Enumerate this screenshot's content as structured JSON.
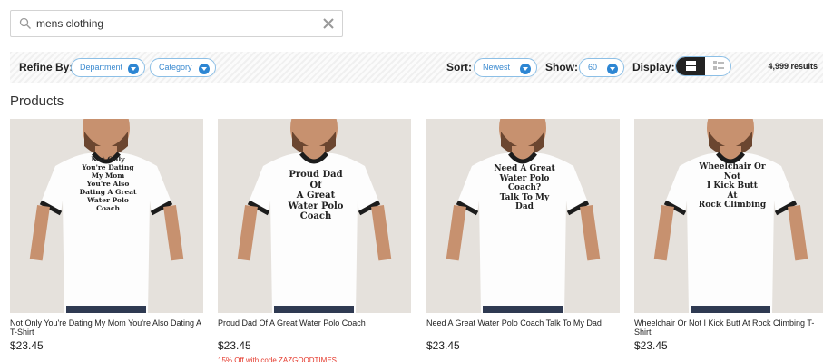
{
  "search": {
    "value": "mens clothing",
    "placeholder": ""
  },
  "refine": {
    "label": "Refine By:",
    "department": "Department",
    "category": "Category",
    "sort_label": "Sort:",
    "sort_value": "Newest",
    "show_label": "Show:",
    "show_value": "60",
    "display_label": "Display:",
    "results": "4,999 results"
  },
  "products_heading": "Products",
  "products": [
    {
      "name": "Not Only You're Dating My Mom You're Also Dating A T-Shirt",
      "price": "$23.45",
      "promo": "",
      "shirt_lines": [
        "Not Only",
        "You're Dating",
        "My Mom",
        "You're Also",
        "Dating A Great",
        "Water Polo",
        "Coach"
      ]
    },
    {
      "name": "Proud Dad Of A Great Water Polo Coach",
      "price": "$23.45",
      "promo": "15% Off with code ZAZGOODTIMES",
      "shirt_lines": [
        "Proud Dad",
        "Of",
        "A Great",
        "Water Polo",
        "Coach"
      ]
    },
    {
      "name": "Need A Great Water Polo Coach Talk To My Dad",
      "price": "$23.45",
      "promo": "",
      "shirt_lines": [
        "Need A Great",
        "Water Polo",
        "Coach?",
        "Talk To My",
        "Dad"
      ]
    },
    {
      "name": "Wheelchair Or Not I Kick Butt At Rock Climbing T-Shirt",
      "price": "$23.45",
      "promo": "",
      "shirt_lines": [
        "Wheelchair Or",
        "Not",
        "I Kick Butt",
        "At",
        "Rock Climbing"
      ]
    }
  ],
  "colors": {
    "accent": "#2d86d3",
    "promo": "#e5372a",
    "thumb_bg": "#e5e1dc",
    "shirt": "#fdfdfd",
    "ringer": "#1c1c1c",
    "skin": "#c7916f",
    "beard": "#6b4630",
    "jeans": "#2f3a52"
  }
}
